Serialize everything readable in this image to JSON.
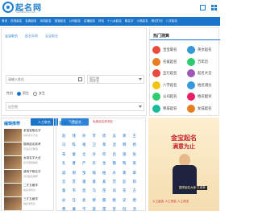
{
  "header": {
    "logo_text": "起名网",
    "logo_sub": "namehome.com"
  },
  "nav": [
    "首页",
    "在线起名",
    "名典起名",
    "诗词起名",
    "宝宝起名",
    "公司起名",
    "店铺起名",
    "好名",
    "十八乡起名",
    "取名字",
    "小说起名",
    "测试打分",
    "八字起名"
  ],
  "form": {
    "tabs": [
      "宝宝取名",
      "起名实例",
      "宝宝取名"
    ],
    "surname_placeholder": "请输入姓氏",
    "date_label": "阳历日期",
    "date_value": "四字名",
    "gender_label": "性别",
    "gender_male": "男生",
    "gender_female": "女生",
    "place_placeholder": "出生地",
    "btn_manual": "人工取名",
    "btn_auto": "免费起名",
    "btn_link": "免费起名和测名"
  },
  "hot": {
    "title": "热门测算",
    "items": [
      {
        "label": "宝宝取名",
        "color": "#e74c3c"
      },
      {
        "label": "英文起名",
        "color": "#3498db"
      },
      {
        "label": "名家起名",
        "color": "#e67e22"
      },
      {
        "label": "万年历",
        "color": "#2ecc71"
      },
      {
        "label": "五行起名",
        "color": "#e74c3c"
      },
      {
        "label": "起名大全",
        "color": "#9b59b6"
      },
      {
        "label": "八字起名",
        "color": "#f1c40f"
      },
      {
        "label": "姓名测分",
        "color": "#3498db"
      },
      {
        "label": "公司起名",
        "color": "#2ecc71"
      },
      {
        "label": "姓名配对",
        "color": "#e91e63"
      },
      {
        "label": "男孩起名",
        "color": "#1abc9c"
      },
      {
        "label": "女孩起名",
        "color": "#e67e22"
      }
    ]
  },
  "rec": {
    "title": "编辑推荐",
    "items": [
      {
        "title": "老宝宝取名字",
        "sub": "好听名字大全"
      },
      {
        "title": "猫咪起名参考",
        "sub": "可爱名字精选"
      },
      {
        "title": "女孩名字大全",
        "sub": "名字寓意解析"
      },
      {
        "title": "虚壳子取名字",
        "sub": "诗词起名推荐"
      },
      {
        "title": "二才五格学",
        "sub": "姓名学知识"
      },
      {
        "title": "三才五格学",
        "sub": "姓名学知识"
      }
    ]
  },
  "bjx": {
    "title": "百家姓",
    "surnames": [
      "赵",
      "钱",
      "孙",
      "李",
      "周",
      "吴",
      "郑",
      "王",
      "冯",
      "陈",
      "褚",
      "卫",
      "蒋",
      "沈",
      "韩",
      "杨",
      "朱",
      "秦",
      "尤",
      "许",
      "何",
      "吕",
      "施",
      "张",
      "孔",
      "曹",
      "严",
      "华",
      "金",
      "魏",
      "陶",
      "姜",
      "戚",
      "谢",
      "邹",
      "喻",
      "柏",
      "水",
      "窦",
      "章",
      "云",
      "苏",
      "潘",
      "葛",
      "奚",
      "范",
      "彭",
      "郎",
      "鲁",
      "韦",
      "昌",
      "马",
      "苗",
      "凤",
      "花",
      "方",
      "俞",
      "任",
      "袁",
      "柳",
      "酆",
      "鲍",
      "史",
      "唐",
      "费",
      "廉",
      "岑",
      "薛",
      "雷",
      "贺",
      "倪",
      "汤"
    ]
  },
  "ad": {
    "line1": "金宝起名",
    "line2": "满意为止",
    "caption": "国学起名大师 王老师",
    "links": "人工起名   人工测名   人工改名"
  }
}
